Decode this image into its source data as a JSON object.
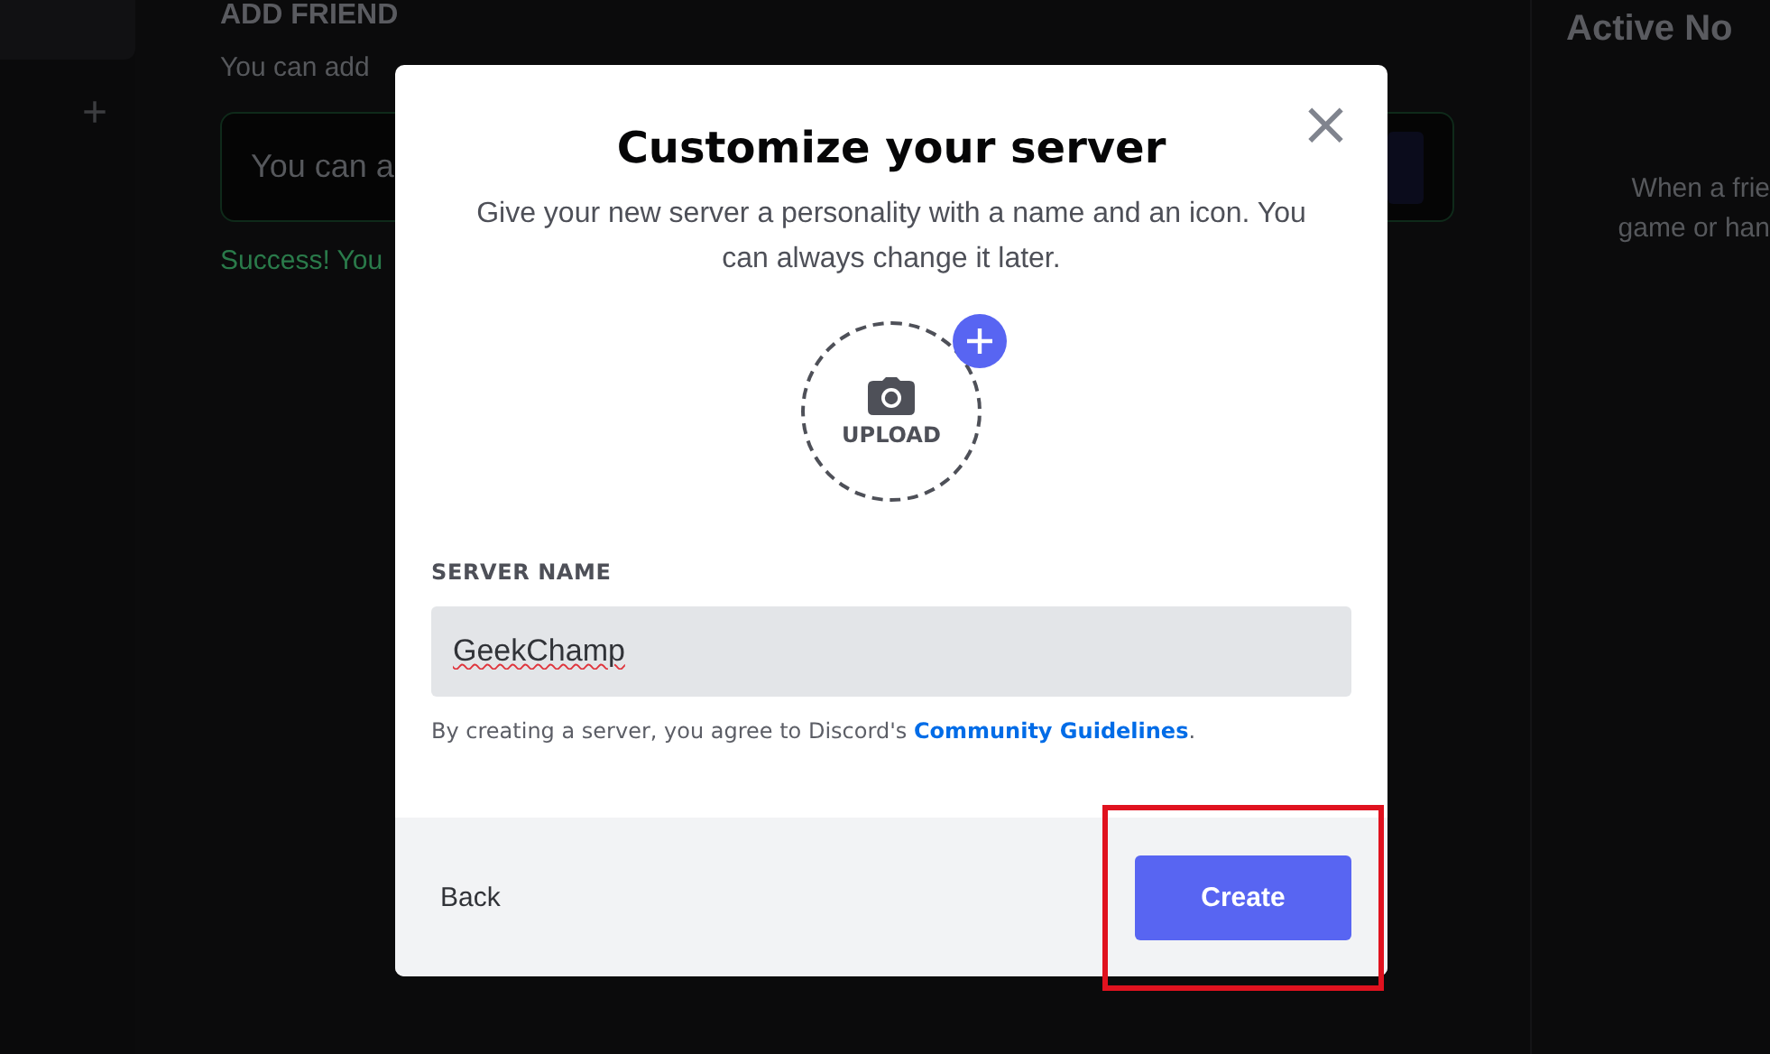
{
  "background": {
    "rail": {
      "add_label": "+"
    },
    "add_friend": {
      "heading": "ADD FRIEND",
      "description": "You can add",
      "input_placeholder": "You can a",
      "status": "Success! You"
    },
    "active_now": {
      "title": "Active No",
      "lines": [
        "When a frie",
        "game or han"
      ]
    }
  },
  "modal": {
    "title": "Customize your server",
    "subtitle": "Give your new server a personality with a name and an icon. You can always change it later.",
    "close_label": "×",
    "upload_label": "UPLOAD",
    "field_label": "SERVER NAME",
    "server_name": "GeekChamp",
    "terms_text": "By creating a server, you agree to Discord's",
    "terms_link": "Community Guidelines",
    "terms_end": ".",
    "back_label": "Back",
    "create_label": "Create",
    "create_highlighted": true
  }
}
